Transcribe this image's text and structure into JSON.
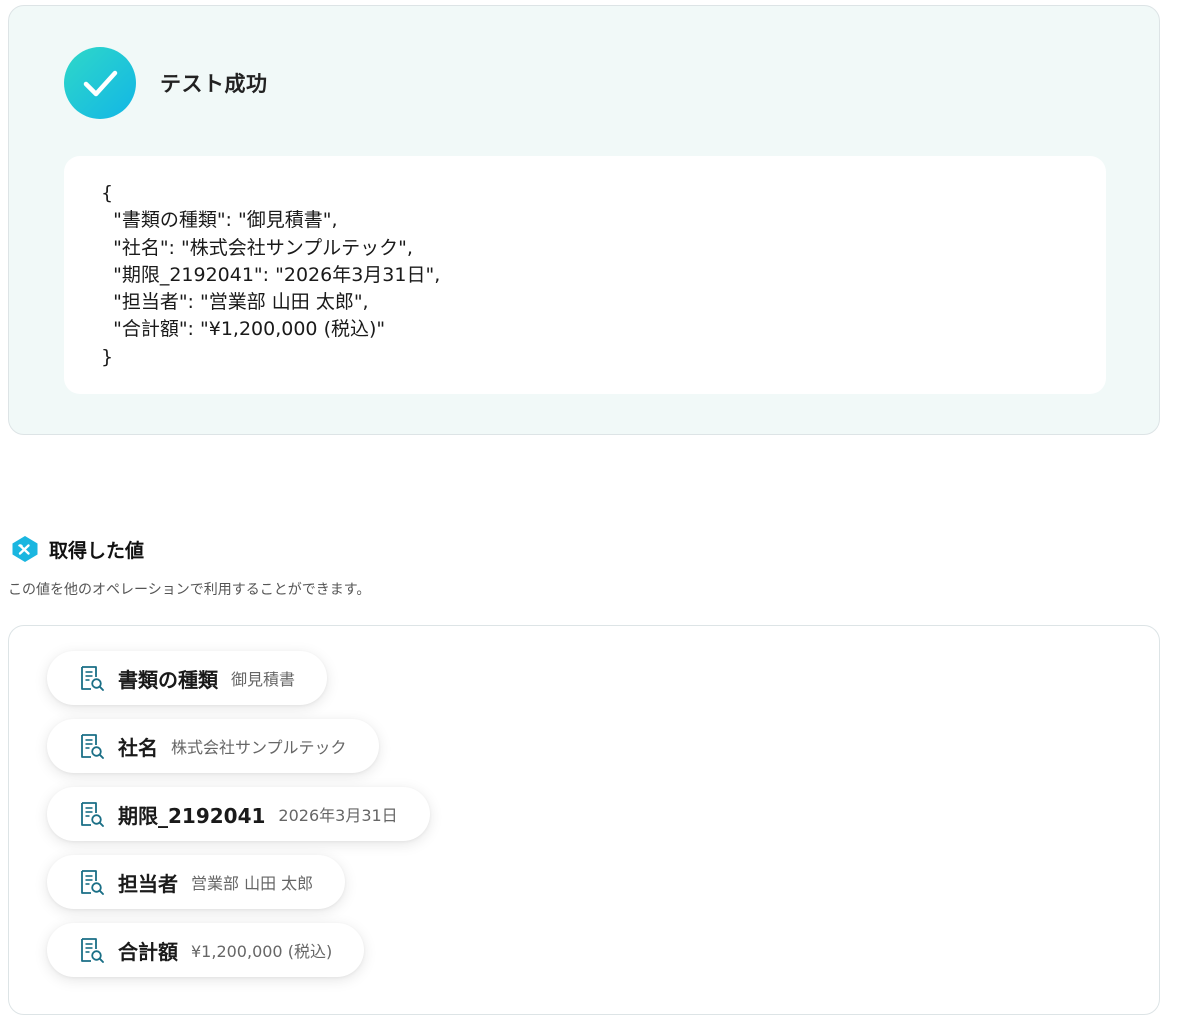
{
  "result": {
    "title": "テスト成功",
    "json_text": "{\n  \"書類の種類\": \"御見積書\",\n  \"社名\": \"株式会社サンプルテック\",\n  \"期限_2192041\": \"2026年3月31日\",\n  \"担当者\": \"営業部 山田 太郎\",\n  \"合計額\": \"¥1,200,000 (税込)\"\n}"
  },
  "values_section": {
    "title": "取得した値",
    "description": "この値を他のオペレーションで利用することができます。",
    "items": [
      {
        "label": "書類の種類",
        "value": "御見積書"
      },
      {
        "label": "社名",
        "value": "株式会社サンプルテック"
      },
      {
        "label": "期限_2192041",
        "value": "2026年3月31日"
      },
      {
        "label": "担当者",
        "value": "営業部 山田 太郎"
      },
      {
        "label": "合計額",
        "value": "¥1,200,000 (税込)"
      }
    ]
  },
  "colors": {
    "success_gradient_start": "#2fd8c8",
    "success_gradient_end": "#12b6e6",
    "panel_background": "#f1f9f8",
    "icon_accent": "#1a6f86"
  },
  "icons": {
    "success": "check-icon",
    "section": "variable-icon",
    "chip": "document-search-icon"
  }
}
